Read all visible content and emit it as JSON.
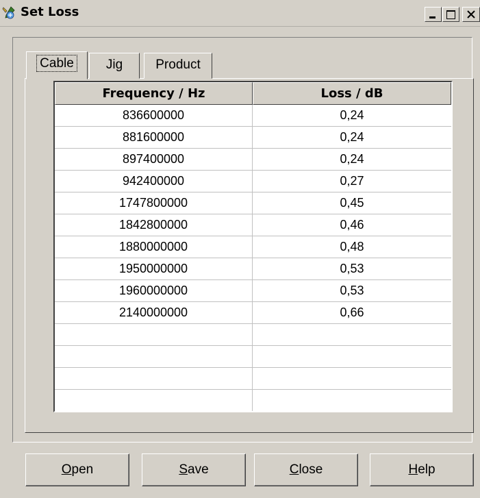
{
  "window": {
    "title": "Set Loss",
    "app_icon": "app-tools-icon",
    "controls": [
      "minimize-icon",
      "maximize-icon",
      "close-icon"
    ]
  },
  "tabs": [
    {
      "label": "Cable",
      "active": true
    },
    {
      "label": "Jig",
      "active": false
    },
    {
      "label": "Product",
      "active": false
    }
  ],
  "table": {
    "headers": [
      "Frequency / Hz",
      "Loss / dB"
    ],
    "rows": [
      [
        "836600000",
        "0,24"
      ],
      [
        "881600000",
        "0,24"
      ],
      [
        "897400000",
        "0,24"
      ],
      [
        "942400000",
        "0,27"
      ],
      [
        "1747800000",
        "0,45"
      ],
      [
        "1842800000",
        "0,46"
      ],
      [
        "1880000000",
        "0,48"
      ],
      [
        "1950000000",
        "0,53"
      ],
      [
        "1960000000",
        "0,53"
      ],
      [
        "2140000000",
        "0,66"
      ],
      [
        "",
        ""
      ],
      [
        "",
        ""
      ],
      [
        "",
        ""
      ],
      [
        "",
        ""
      ]
    ]
  },
  "buttons": {
    "open": {
      "accel": "O",
      "rest": "pen"
    },
    "save": {
      "accel": "S",
      "rest": "ave"
    },
    "close": {
      "accel": "C",
      "rest": "lose"
    },
    "help": {
      "accel": "H",
      "rest": "elp"
    }
  }
}
